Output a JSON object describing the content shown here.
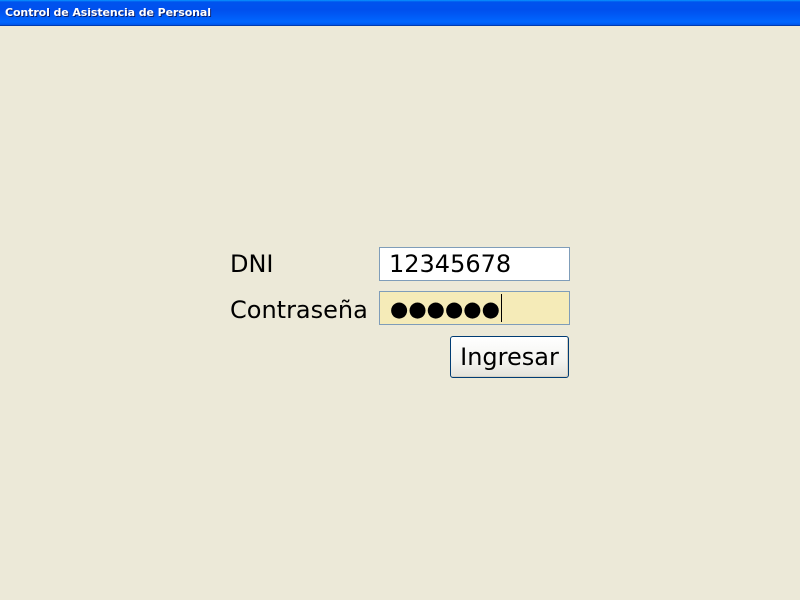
{
  "window": {
    "title": "Control de Asistencia de Personal"
  },
  "form": {
    "dni_label": "DNI",
    "dni_value": "12345678",
    "password_label": "Contraseña",
    "password_masked": "●●●●●●",
    "password_field_bg": "#F5EBB8",
    "submit_label": "Ingresar"
  },
  "colors": {
    "titlebar": "#0054E3",
    "window_bg": "#ECE9D8",
    "field_border": "#7F9DB9"
  }
}
